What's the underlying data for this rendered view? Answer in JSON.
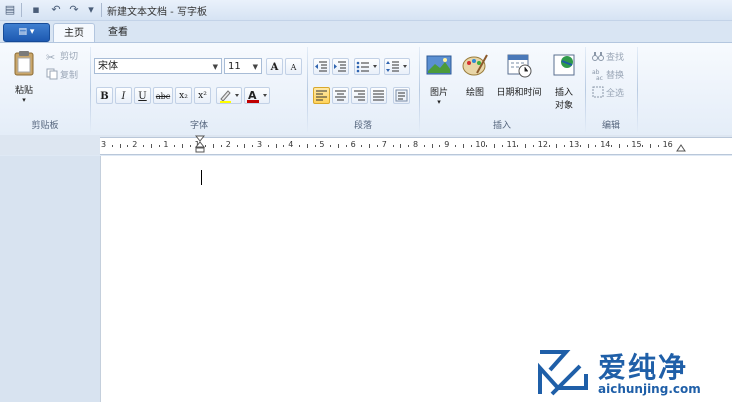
{
  "window": {
    "title": "新建文本文档 - 写字板"
  },
  "tabs": [
    {
      "label": "主页"
    },
    {
      "label": "查看"
    }
  ],
  "clipboard": {
    "paste_label": "粘贴",
    "cut_label": "剪切",
    "copy_label": "复制",
    "group_label": "剪贴板"
  },
  "font": {
    "family": "宋体",
    "size": "11",
    "group_label": "字体",
    "grow_label": "A",
    "shrink_label": "A",
    "bold_label": "B",
    "italic_label": "I",
    "underline_label": "U",
    "strike_label": "abc",
    "subscript_label": "x₂",
    "superscript_label": "x²"
  },
  "paragraph": {
    "group_label": "段落"
  },
  "insert": {
    "picture_label": "图片",
    "paint_label": "绘图",
    "datetime_label": "日期和时间",
    "object_label_1": "插入",
    "object_label_2": "对象",
    "group_label": "插入"
  },
  "editing": {
    "find_label": "查找",
    "replace_label": "替换",
    "select_all_label": "全选",
    "group_label": "编辑"
  },
  "ruler": {
    "labels": [
      "3",
      "2",
      "1",
      "1",
      "2",
      "3",
      "4",
      "5",
      "6",
      "7",
      "8",
      "9",
      "10",
      "11",
      "12",
      "13",
      "14",
      "15",
      "16"
    ]
  },
  "watermark": {
    "brand": "爱纯净",
    "url": "aichunjing.com"
  },
  "colors": {
    "accent": "#1f5fa8",
    "file_button": "#2a68bf",
    "highlight_active": "#ffd35c"
  }
}
